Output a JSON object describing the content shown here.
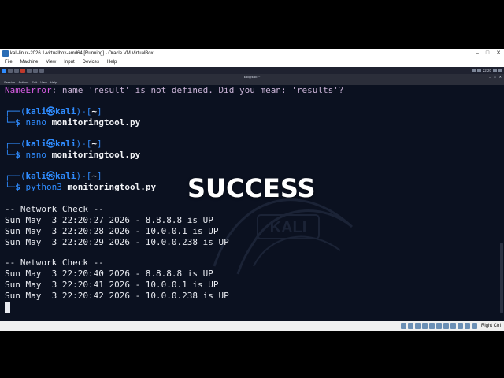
{
  "window": {
    "title": "kali-linux-2026.1-virtualbox-amd64 [Running] - Oracle VM VirtualBox",
    "menu": [
      "File",
      "Machine",
      "View",
      "Input",
      "Devices",
      "Help"
    ],
    "host_key": "Right Ctrl"
  },
  "kali_panel": {
    "clock": "22:20"
  },
  "terminal": {
    "title": "kali@kali: ~",
    "menu": [
      "Session",
      "Actions",
      "Edit",
      "View",
      "Help"
    ],
    "error_label": "NameError",
    "error_message": ": name 'result' is not defined. Did you mean: 'results'?",
    "prompts": [
      {
        "user": "kali",
        "host": "kali",
        "dir": "~",
        "cmd_prog": "nano",
        "cmd_arg": "monitoringtool.py"
      },
      {
        "user": "kali",
        "host": "kali",
        "dir": "~",
        "cmd_prog": "nano",
        "cmd_arg": "monitoringtool.py"
      },
      {
        "user": "kali",
        "host": "kali",
        "dir": "~",
        "cmd_prog": "python3",
        "cmd_arg": "monitoringtool.py"
      }
    ],
    "output": [
      "-- Network Check --",
      "Sun May  3 22:20:27 2026 - 8.8.8.8 is UP",
      "Sun May  3 22:20:28 2026 - 10.0.0.1 is UP",
      "Sun May  3 22:20:29 2026 - 10.0.0.238 is UP",
      "",
      "-- Network Check --",
      "Sun May  3 22:20:40 2026 - 8.8.8.8 is UP",
      "Sun May  3 22:20:41 2026 - 10.0.0.1 is UP",
      "Sun May  3 22:20:42 2026 - 10.0.0.238 is UP"
    ]
  },
  "overlay_text": "SUCCESS",
  "colors": {
    "terminal_bg": "#0b1120",
    "prompt_blue": "#2f8cff",
    "error_pink": "#d55ce0"
  }
}
